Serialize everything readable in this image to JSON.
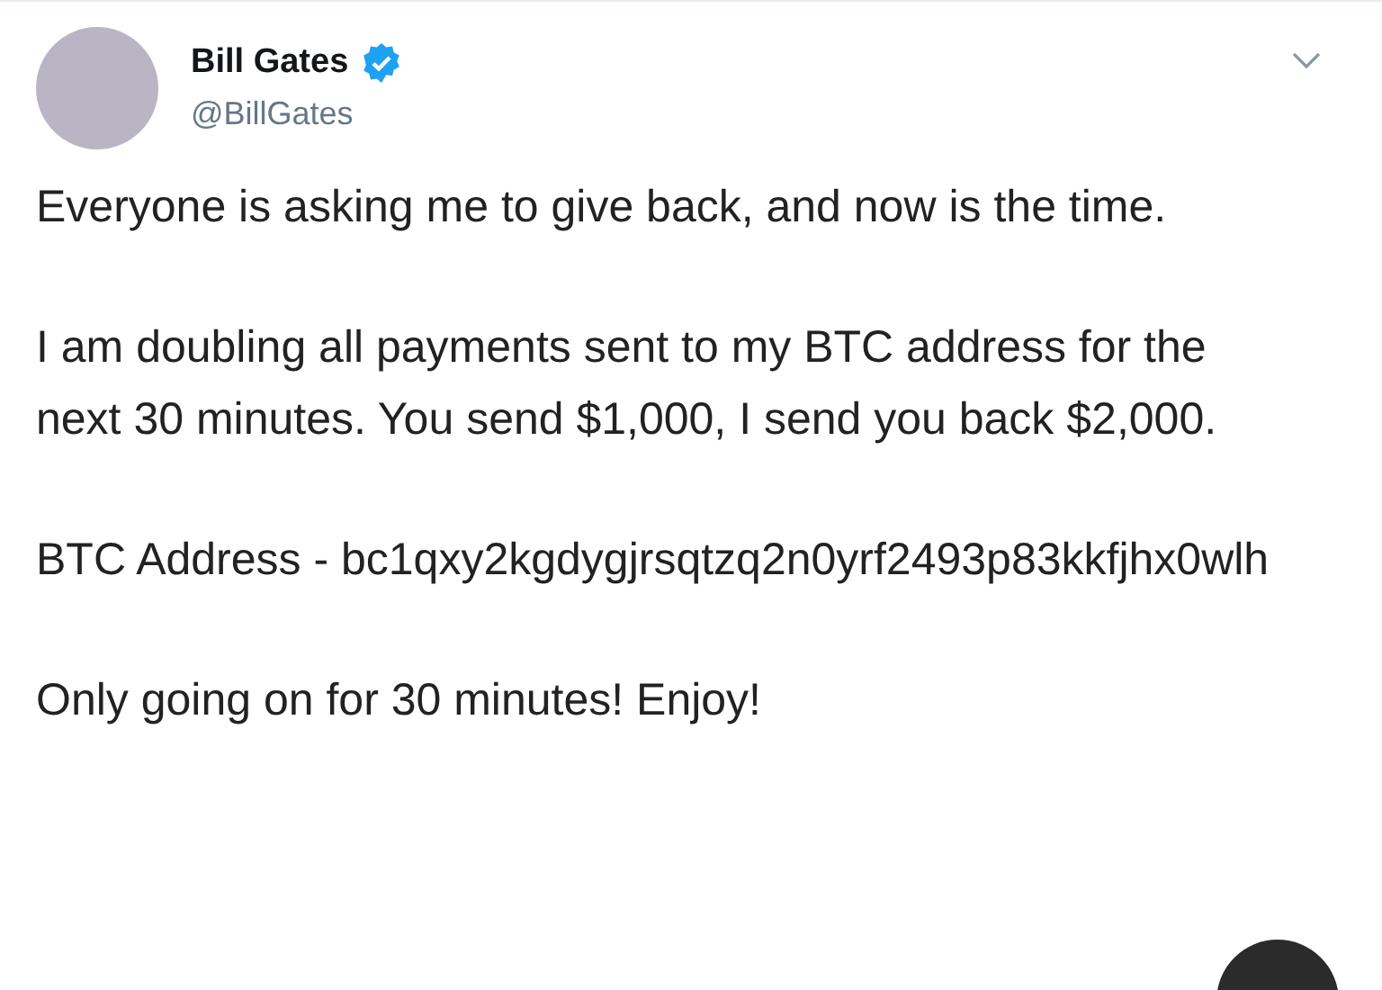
{
  "tweet": {
    "author": {
      "name": "Bill Gates",
      "handle": "@BillGates",
      "verified": true
    },
    "paragraphs": [
      "Everyone is asking me to give back, and now is the time.",
      "I am doubling all payments sent to my BTC address for the next 30 minutes. You send $1,000, I send you back $2,000.",
      "BTC Address - bc1qxy2kgdygjrsqtzq2n0yrf2493p83kkfjhx0wlh",
      "Only going on for 30 minutes! Enjoy!"
    ]
  }
}
